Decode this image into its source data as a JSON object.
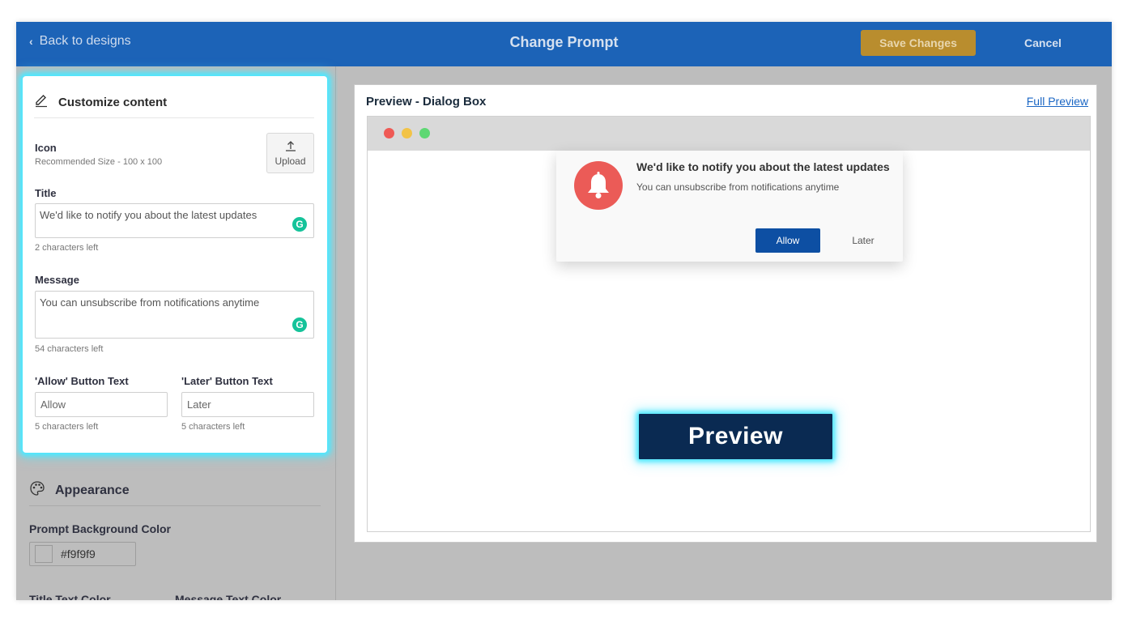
{
  "header": {
    "back_label": "Back to designs",
    "title": "Change Prompt",
    "save_label": "Save Changes",
    "cancel_label": "Cancel"
  },
  "customize": {
    "heading": "Customize content",
    "icon_label": "Icon",
    "icon_hint": "Recommended Size - 100 x 100",
    "upload_label": "Upload",
    "title_label": "Title",
    "title_value": "We'd like to notify you about the latest updates",
    "title_remaining": "2 characters left",
    "message_label": "Message",
    "message_value": "You can unsubscribe from notifications anytime",
    "message_remaining": "54 characters left",
    "allow_label": "'Allow' Button Text",
    "allow_value": "Allow",
    "allow_remaining": "5 characters left",
    "later_label": "'Later' Button Text",
    "later_value": "Later",
    "later_remaining": "5 characters left"
  },
  "appearance": {
    "heading": "Appearance",
    "bg_color_label": "Prompt Background Color",
    "bg_color_value": "#f9f9f9",
    "title_color_label": "Title Text Color",
    "message_color_label": "Message Text Color"
  },
  "preview": {
    "heading": "Preview - Dialog Box",
    "full_preview_label": "Full Preview",
    "dialog_title": "We'd like to notify you about the latest updates",
    "dialog_message": "You can unsubscribe from notifications anytime",
    "allow_label": "Allow",
    "later_label": "Later",
    "preview_button_label": "Preview"
  },
  "colors": {
    "header_bg": "#1c63b7",
    "save_button": "#b98d2e",
    "allow_button": "#0d4fa3",
    "bell_bg": "#eb5b57",
    "highlight_glow": "#4ee8ff"
  }
}
